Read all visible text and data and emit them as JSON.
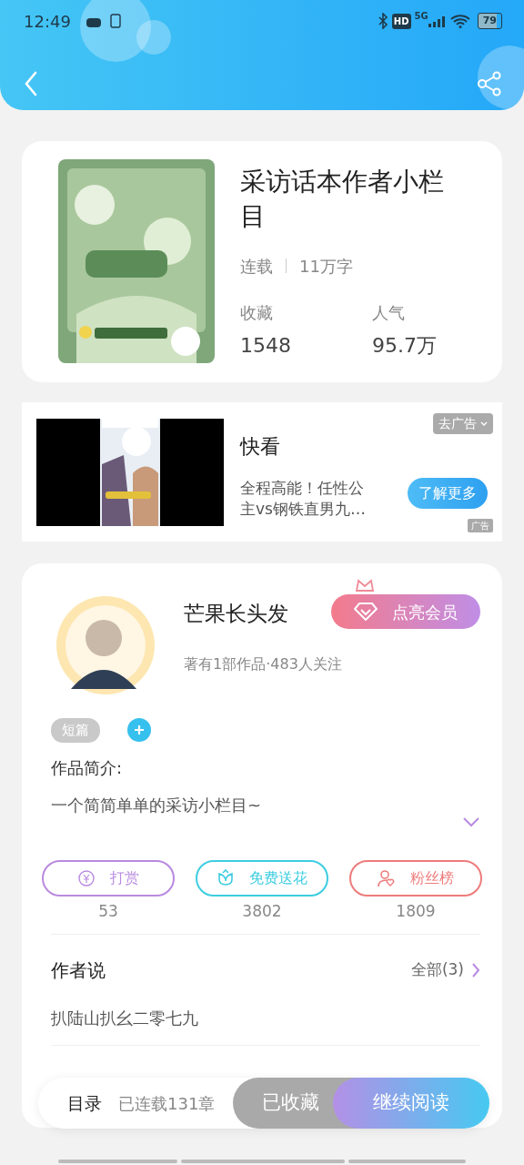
{
  "status_bar": {
    "time": "12:49",
    "hd": "HD",
    "network": "5G",
    "battery": "79"
  },
  "book": {
    "title": "采访话本作者小栏目",
    "status": "连载",
    "word_count": "11万字",
    "stats": [
      {
        "label": "收藏",
        "value": "1548"
      },
      {
        "label": "人气",
        "value": "95.7万"
      }
    ]
  },
  "ad": {
    "remove_label": "去广告",
    "title": "快看",
    "description": "全程高能！任性公主vs钢铁直男九…",
    "button": "了解更多",
    "ad_mark": "广告"
  },
  "author": {
    "name": "芒果长头发",
    "vip_button": "点亮会员",
    "meta": "著有1部作品·483人关注",
    "tags": [
      "短篇"
    ],
    "intro_label": "作品简介:",
    "intro": "一个简简单单的采访小栏目~"
  },
  "actions": [
    {
      "kind": "reward",
      "label": "打赏",
      "count": "53",
      "color": "#b98ae0"
    },
    {
      "kind": "flower",
      "label": "免费送花",
      "count": "3802",
      "color": "#3ccde0"
    },
    {
      "kind": "fans",
      "label": "粉丝榜",
      "count": "1809",
      "color": "#ee7b7b"
    }
  ],
  "author_says": {
    "title": "作者说",
    "more": "全部(3)",
    "text": "扒陆山扒幺二零七九"
  },
  "bottom_bar": {
    "catalog": "目录",
    "chapters": "已连载131章",
    "collect_button": "已收藏",
    "read_button": "继续阅读"
  }
}
